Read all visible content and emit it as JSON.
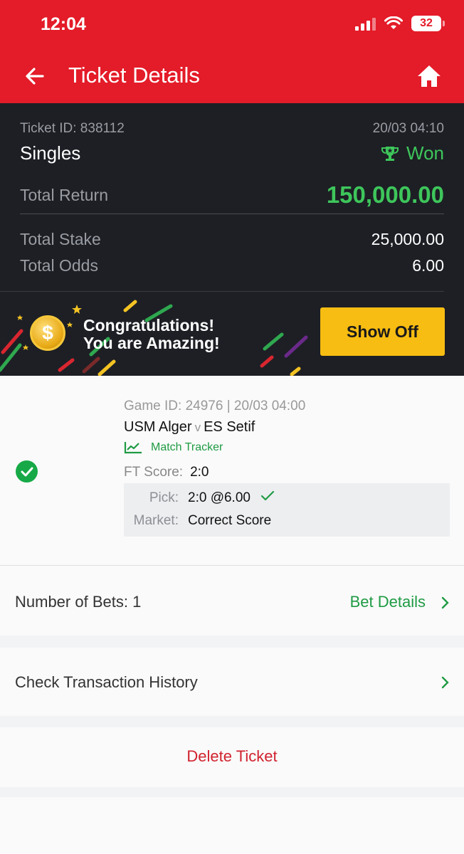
{
  "status_bar": {
    "time": "12:04",
    "battery": "32"
  },
  "header": {
    "title": "Ticket Details"
  },
  "ticket": {
    "id_label": "Ticket ID: 838112",
    "datetime": "20/03 04:10",
    "bet_type": "Singles",
    "status": "Won",
    "total_return_label": "Total Return",
    "total_return": "150,000.00",
    "total_stake_label": "Total Stake",
    "total_stake": "25,000.00",
    "total_odds_label": "Total Odds",
    "total_odds": "6.00"
  },
  "banner": {
    "line1": "Congratulations!",
    "line2": "You are Amazing!",
    "button": "Show Off"
  },
  "selection": {
    "game_meta": "Game ID: 24976 | 20/03 04:00",
    "home": "USM Alger",
    "vs": "v",
    "away": "ES Setif",
    "tracker": "Match Tracker",
    "ft_label": "FT Score:",
    "ft_value": "2:0",
    "pick_label": "Pick:",
    "pick_value": "2:0 @6.00",
    "market_label": "Market:",
    "market_value": "Correct Score"
  },
  "bets_row": {
    "label": "Number of Bets: 1",
    "link": "Bet Details"
  },
  "history_row": {
    "label": "Check Transaction History"
  },
  "delete_label": "Delete Ticket",
  "colors": {
    "brand_red": "#e41b28",
    "win_green": "#3ec65b",
    "link_green": "#1f9b44",
    "button_yellow": "#f8bd12",
    "dark_panel": "#1d1f25"
  }
}
